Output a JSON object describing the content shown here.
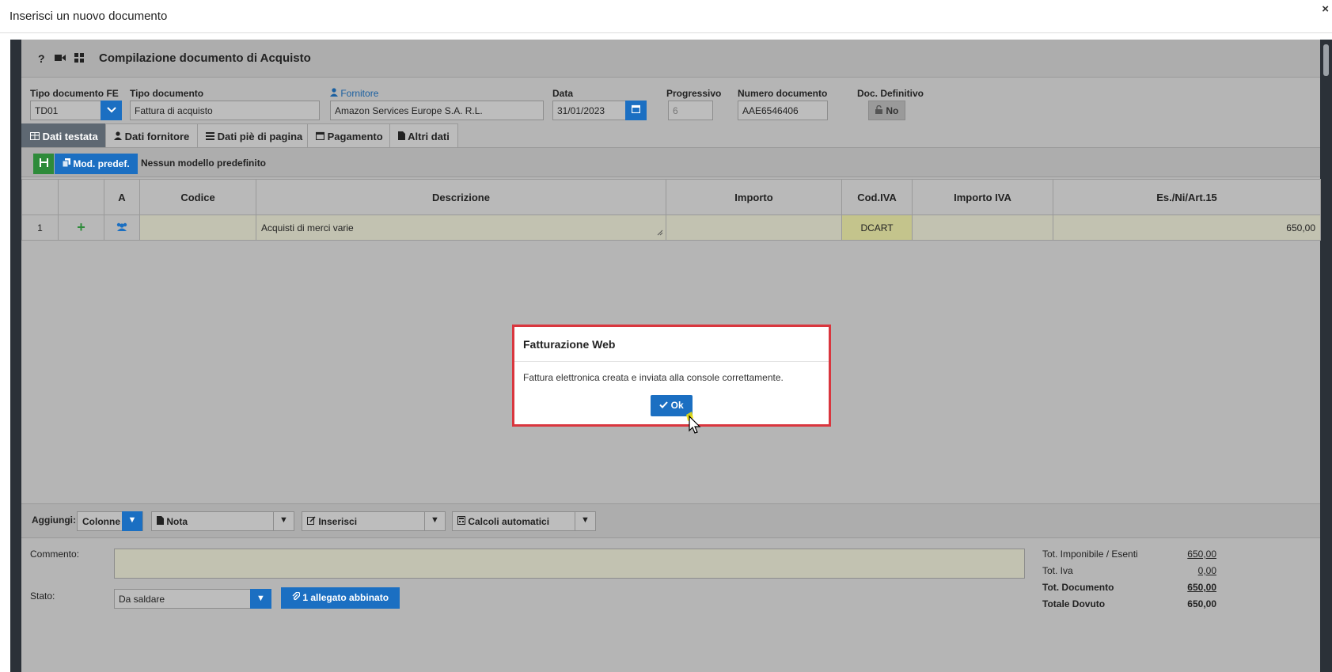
{
  "window": {
    "title": "Inserisci un nuovo documento",
    "close_icon": "×"
  },
  "header": {
    "title": "Compilazione documento di Acquisto"
  },
  "fields": {
    "tipo_fe": {
      "label": "Tipo documento FE",
      "value": "TD01"
    },
    "tipo_doc": {
      "label": "Tipo documento",
      "value": "Fattura di acquisto"
    },
    "fornitore": {
      "label": "Fornitore",
      "value": "Amazon Services Europe S.A. R.L."
    },
    "data": {
      "label": "Data",
      "value": "31/01/2023"
    },
    "progressivo": {
      "label": "Progressivo",
      "value": "6"
    },
    "numero": {
      "label": "Numero documento",
      "value": "AAE6546406"
    },
    "definitivo": {
      "label": "Doc. Definitivo",
      "value": "No"
    }
  },
  "tabs": [
    {
      "label": "Dati testata",
      "active": true
    },
    {
      "label": "Dati fornitore",
      "active": false
    },
    {
      "label": "Dati piè di pagina",
      "active": false
    },
    {
      "label": "Pagamento",
      "active": false
    },
    {
      "label": "Altri dati",
      "active": false
    }
  ],
  "toolbar": {
    "mod_label": "Mod. predef.",
    "mod_text": "Nessun modello predefinito"
  },
  "table": {
    "columns": [
      "",
      "",
      "A",
      "Codice",
      "Descrizione",
      "Importo",
      "Cod.IVA",
      "Importo IVA",
      "Es./Ni/Art.15"
    ],
    "rows": [
      {
        "num": "1",
        "codice": "",
        "descrizione": "Acquisti di merci varie",
        "importo": "",
        "cod_iva": "DCART",
        "importo_iva": "",
        "esente": "650,00"
      }
    ]
  },
  "dialog": {
    "title": "Fatturazione Web",
    "message": "Fattura elettronica creata e inviata alla console correttamente.",
    "ok_label": "Ok"
  },
  "addbar": {
    "label": "Aggiungi:",
    "colonne": "Colonne",
    "nota": "Nota",
    "inserisci": "Inserisci",
    "calcoli": "Calcoli automatici"
  },
  "footer": {
    "commento_label": "Commento:",
    "stato_label": "Stato:",
    "stato_value": "Da saldare",
    "allegato_label": "1 allegato abbinato"
  },
  "totals": [
    {
      "label": "Tot. Imponibile / Esenti",
      "value": "650,00"
    },
    {
      "label": "Tot. Iva",
      "value": "0,00"
    },
    {
      "label": "Tot. Documento",
      "value": "650,00"
    },
    {
      "label": "Totale Dovuto",
      "value": "650,00"
    }
  ],
  "colors": {
    "accent": "#1b6fc2",
    "success": "#2e8b3a",
    "dialog_border": "#d9363e",
    "tab_active": "#5e6872"
  }
}
